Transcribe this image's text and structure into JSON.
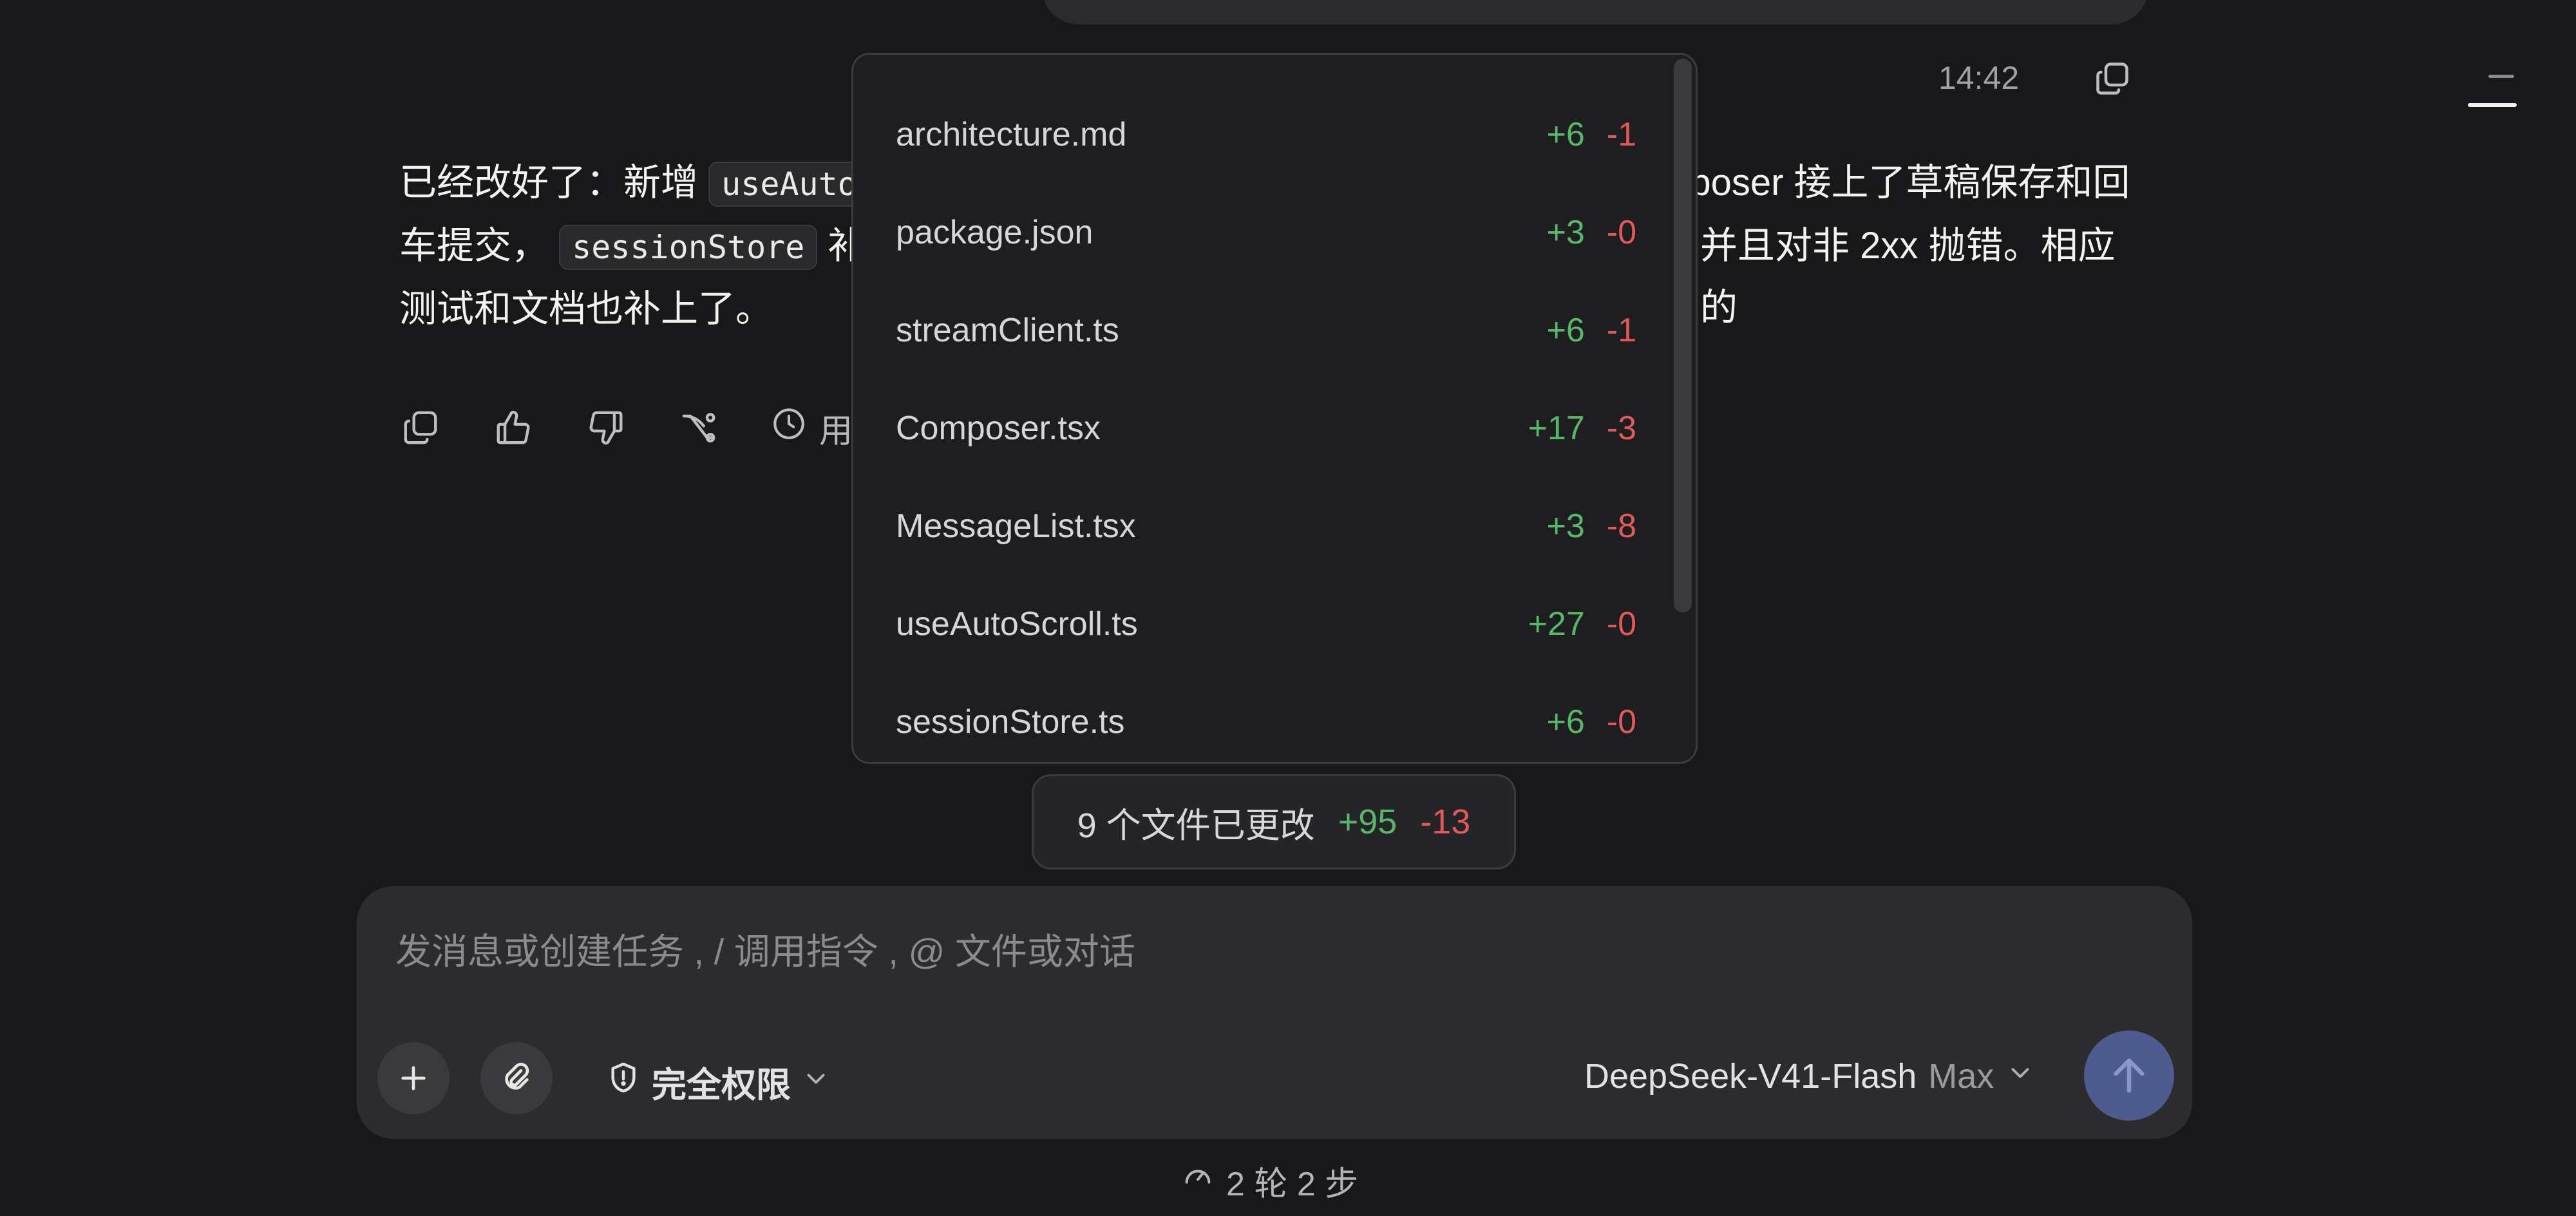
{
  "header": {
    "timestamp": "14:42"
  },
  "message": {
    "line1_prefix": "已经改好了：新增",
    "code1": "useAutoS",
    "line1_suffix": "mposer 接上了草稿保存和回",
    "line2_prefix": "车提交，",
    "code2": "sessionStore",
    "line2_mid": "补",
    "line2_suffix": "并且对非 2xx 抛错。相应的",
    "line3": "测试和文档也补上了。",
    "duration_label": "用"
  },
  "changed_files": [
    {
      "name": "architecture.md",
      "added": "+6",
      "removed": "-1"
    },
    {
      "name": "package.json",
      "added": "+3",
      "removed": "-0"
    },
    {
      "name": "streamClient.ts",
      "added": "+6",
      "removed": "-1"
    },
    {
      "name": "Composer.tsx",
      "added": "+17",
      "removed": "-3"
    },
    {
      "name": "MessageList.tsx",
      "added": "+3",
      "removed": "-8"
    },
    {
      "name": "useAutoScroll.ts",
      "added": "+27",
      "removed": "-0"
    },
    {
      "name": "sessionStore.ts",
      "added": "+6",
      "removed": "-0"
    }
  ],
  "summary": {
    "label": "9 个文件已更改",
    "added": "+95",
    "removed": "-13"
  },
  "composer": {
    "placeholder": "发消息或创建任务 , / 调用指令 , @ 文件或对话",
    "permission": "完全权限",
    "model_name": "DeepSeek-V41-Flash",
    "model_tier": "Max"
  },
  "footer": {
    "stats": "2 轮 2 步"
  },
  "colors": {
    "added": "#58b86a",
    "removed": "#e05a5a",
    "send": "#4d5b8f"
  },
  "icons": [
    "copy-icon",
    "hamburger-icon",
    "thumbs-up-icon",
    "thumbs-down-icon",
    "branch-icon",
    "clock-icon",
    "plus-icon",
    "paperclip-icon",
    "shield-icon",
    "chevron-down-icon",
    "arrow-up-icon",
    "gauge-icon"
  ]
}
